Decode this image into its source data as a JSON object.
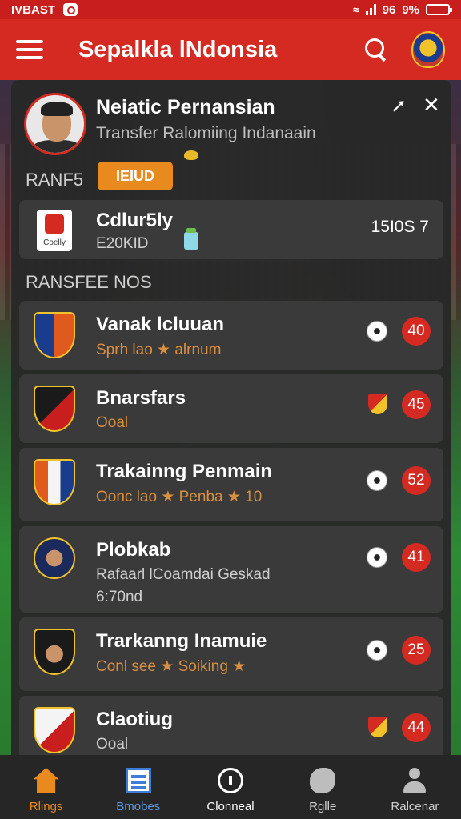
{
  "status_bar": {
    "carrier": "IVBAST",
    "right_text": "96",
    "battery": "9%"
  },
  "app_bar": {
    "title": "Sepalkla lNdonsia"
  },
  "profile": {
    "name": "Neiatic Pernansian",
    "subtitle": "Transfer Ralomiing Indanaain",
    "label": "RANF5",
    "badge": "IEIUD"
  },
  "club": {
    "name": "Cdlur5ly",
    "sub": "E20KID",
    "logo_caption": "Coelly",
    "value": "15I0S 7"
  },
  "section_title": "RANSFEE NOS",
  "rows": [
    {
      "title": "Vanak lcluuan",
      "sub": "Sprh lao ★ alrnum",
      "sub2": "",
      "badge": "40",
      "icon": "soccer-ball-icon"
    },
    {
      "title": "Bnarsfars",
      "sub": "Ooal",
      "sub2": "",
      "badge": "45",
      "icon": "flag-icon"
    },
    {
      "title": "Trakainng Penmain",
      "sub": "Oonc lao ★ Penba ★ 10",
      "sub2": "",
      "badge": "52",
      "icon": "soccer-ball-icon"
    },
    {
      "title": "Plobkab",
      "sub": "Rafaarl lCoamdai Geskad",
      "sub2": "6:70nd",
      "badge": "41",
      "icon": "soccer-ball-icon"
    },
    {
      "title": "Trarkanng Inamuie",
      "sub": "Conl see ★ Soiking ★",
      "sub2": "",
      "badge": "25",
      "icon": "soccer-ball-icon"
    },
    {
      "title": "Claotiug",
      "sub": "Ooal",
      "sub2": "",
      "badge": "44",
      "icon": "flag-icon"
    }
  ],
  "bottom_nav": [
    {
      "label": "Rlings",
      "icon": "home-icon"
    },
    {
      "label": "Bmobes",
      "icon": "news-icon"
    },
    {
      "label": "Clonneal",
      "icon": "clock-icon"
    },
    {
      "label": "Rglle",
      "icon": "ball-icon"
    },
    {
      "label": "Ralcenar",
      "icon": "person-icon"
    }
  ],
  "colors": {
    "primary": "#d42a22",
    "accent": "#e88a1e",
    "panel": "#282828",
    "card": "#3a3a3a"
  }
}
